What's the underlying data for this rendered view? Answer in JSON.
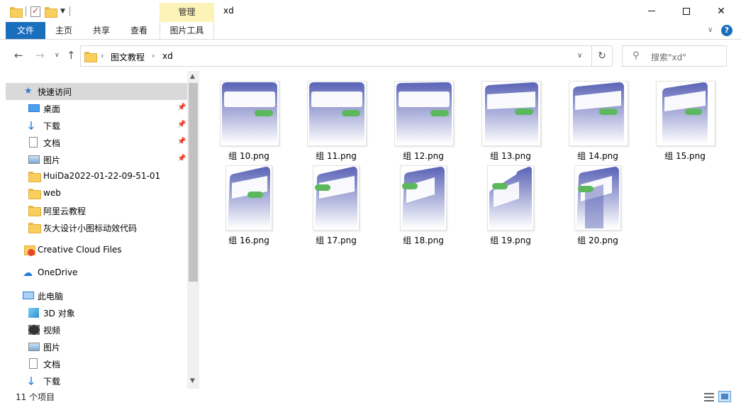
{
  "window": {
    "title": "xd"
  },
  "ribbon": {
    "contextual_tab": "管理",
    "tabs": [
      "文件",
      "主页",
      "共享",
      "查看",
      "图片工具"
    ]
  },
  "address": {
    "crumbs": [
      "图文教程",
      "xd"
    ],
    "search_placeholder": "搜索\"xd\""
  },
  "sidebar": {
    "items": [
      {
        "label": "快速访问",
        "icon": "star-icon"
      },
      {
        "label": "桌面",
        "icon": "desktop-icon",
        "pinned": true
      },
      {
        "label": "下载",
        "icon": "download-icon",
        "pinned": true
      },
      {
        "label": "文档",
        "icon": "document-icon",
        "pinned": true
      },
      {
        "label": "图片",
        "icon": "pictures-icon",
        "pinned": true
      },
      {
        "label": "HuiDa2022-01-22-09-51-01",
        "icon": "folder-icon"
      },
      {
        "label": "web",
        "icon": "folder-icon"
      },
      {
        "label": "阿里云教程",
        "icon": "folder-icon"
      },
      {
        "label": "灰大设计小图标动效代码",
        "icon": "folder-icon"
      },
      {
        "label": "Creative Cloud Files",
        "icon": "creative-cloud-icon"
      },
      {
        "label": "OneDrive",
        "icon": "cloud-icon"
      },
      {
        "label": "此电脑",
        "icon": "computer-icon"
      },
      {
        "label": "3D 对象",
        "icon": "3d-objects-icon"
      },
      {
        "label": "视频",
        "icon": "video-icon"
      },
      {
        "label": "图片",
        "icon": "pictures-icon"
      },
      {
        "label": "文档",
        "icon": "document-icon"
      },
      {
        "label": "下载",
        "icon": "download-icon"
      }
    ]
  },
  "files": [
    {
      "name": "组 10.png"
    },
    {
      "name": "组 11.png"
    },
    {
      "name": "组 12.png"
    },
    {
      "name": "组 13.png"
    },
    {
      "name": "组 14.png"
    },
    {
      "name": "组 15.png"
    },
    {
      "name": "组 16.png"
    },
    {
      "name": "组 17.png"
    },
    {
      "name": "组 18.png"
    },
    {
      "name": "组 19.png"
    },
    {
      "name": "组 20.png"
    }
  ],
  "status": {
    "item_count": "11 个项目"
  },
  "colors": {
    "accent": "#1a6fbd",
    "manage_tab": "#fbf3b8",
    "thumb_blue": "#5b64b8",
    "thumb_green": "#5cb85c"
  }
}
